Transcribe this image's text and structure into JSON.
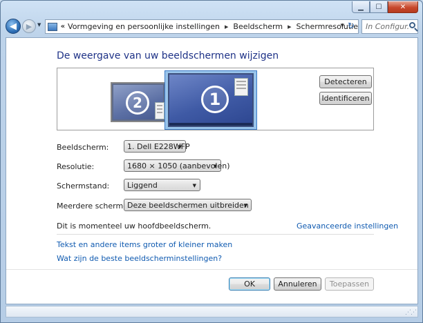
{
  "window": {
    "minimize_glyph": "▁",
    "maximize_glyph": "☐",
    "close_glyph": "✕"
  },
  "nav": {
    "back_glyph": "◀",
    "forward_glyph": "▶",
    "history_glyph": "▼",
    "address_chevron": "«",
    "breadcrumbs": [
      "Vormgeving en persoonlijke instellingen",
      "Beeldscherm",
      "Schermresolutie"
    ],
    "crumb_separator": "▶",
    "dropdown_glyph": "▼",
    "refresh_glyph": "↻",
    "search_placeholder": "In Configur..."
  },
  "main": {
    "title": "De weergave van uw beeldschermen wijzigen",
    "monitors": [
      {
        "number": "2",
        "selected": false
      },
      {
        "number": "1",
        "selected": true
      }
    ],
    "detect_button": "Detecteren",
    "identify_button": "Identificeren",
    "fields": {
      "display_label": "Beeldscherm:",
      "display_value": "1. Dell E228WFP",
      "resolution_label": "Resolutie:",
      "resolution_value": "1680 × 1050 (aanbevolen)",
      "orientation_label": "Schermstand:",
      "orientation_value": "Liggend",
      "multiple_label": "Meerdere schermen:",
      "multiple_value": "Deze beeldschermen uitbreiden"
    },
    "primary_status": "Dit is momenteel uw hoofdbeeldscherm.",
    "advanced_link": "Geavanceerde instellingen",
    "link_text_size": "Tekst en andere items groter of kleiner maken",
    "link_best_settings": "Wat zijn de beste beeldscherminstellingen?",
    "dropdown_arrow": "▼"
  },
  "footer": {
    "ok": "OK",
    "cancel": "Annuleren",
    "apply": "Toepassen"
  },
  "colors": {
    "title": "#1e3287",
    "link": "#0f5ab0",
    "selection": "#99c4ea"
  }
}
